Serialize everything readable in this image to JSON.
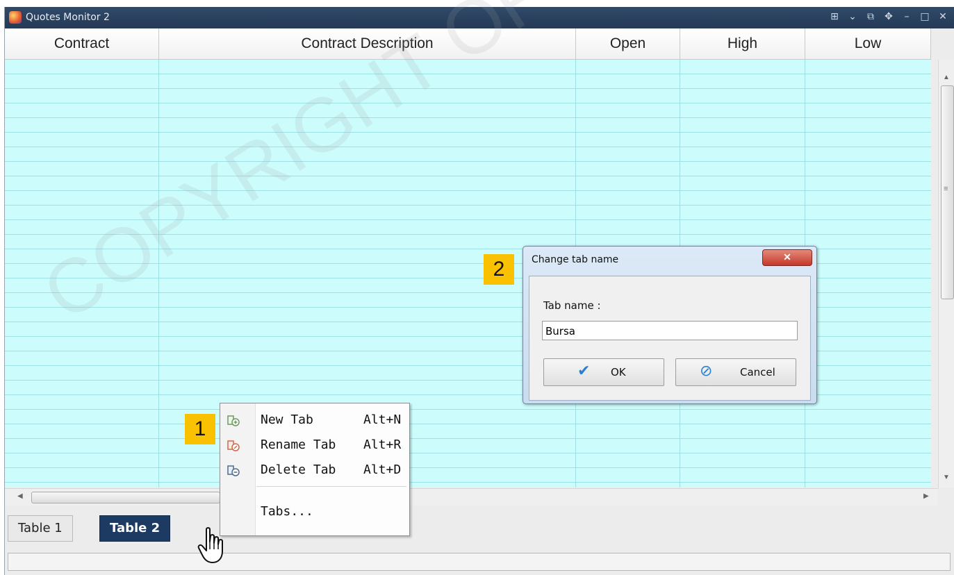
{
  "window": {
    "title": "Quotes Monitor 2"
  },
  "table": {
    "columns": [
      "Contract",
      "Contract Description",
      "Open",
      "High",
      "Low"
    ]
  },
  "tabs": [
    {
      "label": "Table 1",
      "active": false
    },
    {
      "label": "Table 2",
      "active": true
    }
  ],
  "context_menu": {
    "items": [
      {
        "label": "New Tab",
        "shortcut": "Alt+N",
        "icon": "new-tab-icon"
      },
      {
        "label": "Rename Tab",
        "shortcut": "Alt+R",
        "icon": "rename-tab-icon"
      },
      {
        "label": "Delete Tab",
        "shortcut": "Alt+D",
        "icon": "delete-tab-icon"
      }
    ],
    "tabs_item": "Tabs..."
  },
  "dialog": {
    "title": "Change tab name",
    "field_label": "Tab name :",
    "field_value": "Bursa",
    "ok_label": "OK",
    "cancel_label": "Cancel"
  },
  "callouts": {
    "one": "1",
    "two": "2"
  },
  "watermark": "COPYRIGHT OF RHB INVEST M",
  "colors": {
    "grid_background": "#cdfcfc",
    "active_tab": "#1d3a63",
    "callout": "#f9c100",
    "titlebar": "#2b4260"
  }
}
